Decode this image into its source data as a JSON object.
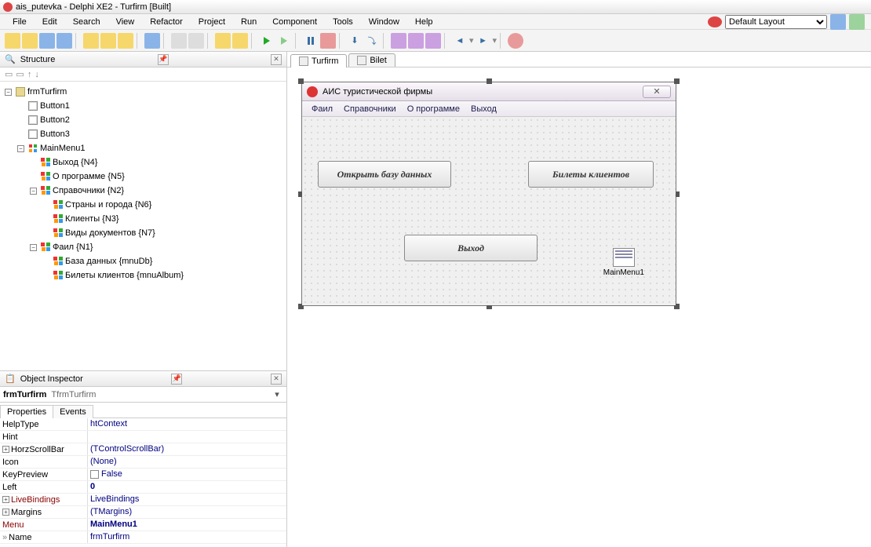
{
  "titlebar": {
    "text": "ais_putevka - Delphi XE2 - Turfirm [Built]"
  },
  "mainmenu": [
    "File",
    "Edit",
    "Search",
    "View",
    "Refactor",
    "Project",
    "Run",
    "Component",
    "Tools",
    "Window",
    "Help"
  ],
  "layout_selected": "Default Layout",
  "panels": {
    "structure": {
      "title": "Structure"
    },
    "inspector": {
      "title": "Object Inspector"
    }
  },
  "structure_tree": {
    "root": "frmTurfirm",
    "buttons": [
      "Button1",
      "Button2",
      "Button3"
    ],
    "mainmenu_node": "MainMenu1",
    "items_top": [
      "Выход  {N4}",
      "О программе  {N5}"
    ],
    "spravochniki": {
      "label": "Справочники  {N2}",
      "children": [
        "Страны и города  {N6}",
        "Клиенты  {N3}",
        "Виды документов  {N7}"
      ]
    },
    "fail": {
      "label": "Фаил  {N1}",
      "children": [
        "База данных  {mnuDb}",
        "Билеты клиентов  {mnuAlbum}"
      ]
    }
  },
  "inspector": {
    "object_name": "frmTurfirm",
    "object_class": "TfrmTurfirm",
    "tabs": [
      "Properties",
      "Events"
    ],
    "rows": [
      {
        "name": "HelpType",
        "val": "htContext"
      },
      {
        "name": "Hint",
        "val": ""
      },
      {
        "name": "HorzScrollBar",
        "val": "(TControlScrollBar)",
        "exp": true
      },
      {
        "name": "Icon",
        "val": "(None)"
      },
      {
        "name": "KeyPreview",
        "val": "False",
        "chk": true
      },
      {
        "name": "Left",
        "val": "0",
        "bold": true
      },
      {
        "name": "LiveBindings",
        "val": "LiveBindings",
        "red": true,
        "exp": true
      },
      {
        "name": "Margins",
        "val": "(TMargins)",
        "exp": true
      },
      {
        "name": "Menu",
        "val": "MainMenu1",
        "red": true,
        "bold": true
      },
      {
        "name": "Name",
        "val": "frmTurfirm",
        "marker": true
      }
    ]
  },
  "design_tabs": [
    {
      "label": "Turfirm",
      "active": true
    },
    {
      "label": "Bilet",
      "active": false
    }
  ],
  "form": {
    "title": "АИС туристической фирмы",
    "menu": [
      "Фаил",
      "Справочники",
      "О программе",
      "Выход"
    ],
    "btn1": "Открыть базу данных",
    "btn2": "Билеты клиентов",
    "btn3": "Выход",
    "mm_label": "MainMenu1"
  }
}
